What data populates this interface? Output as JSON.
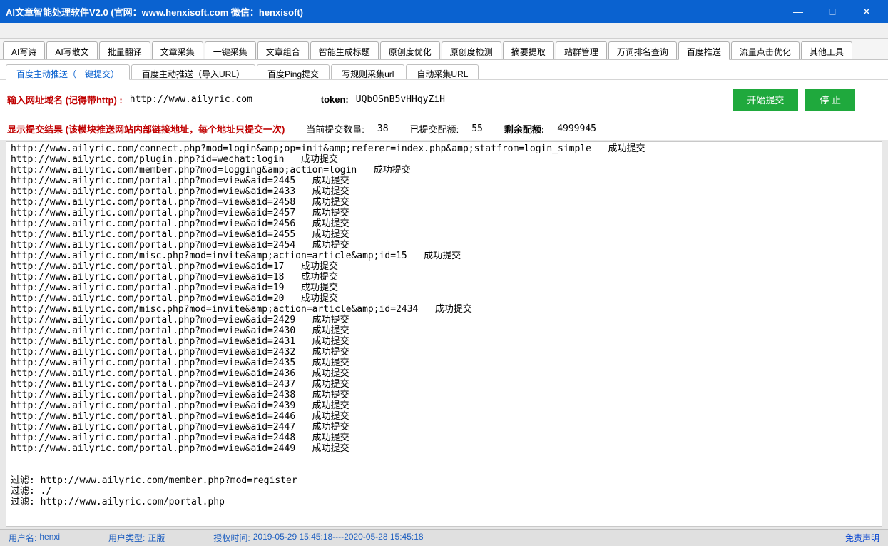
{
  "title": "AI文章智能处理软件V2.0  (官网：www.henxisoft.com  微信：henxisoft)",
  "tabs1": [
    "AI写诗",
    "AI写散文",
    "批量翻译",
    "文章采集",
    "一键采集",
    "文章组合",
    "智能生成标题",
    "原创度优化",
    "原创度检测",
    "摘要提取",
    "站群管理",
    "万词排名查询",
    "百度推送",
    "流量点击优化",
    "其他工具"
  ],
  "tabs1_active": 12,
  "tabs2": [
    "百度主动推送（一键提交）",
    "百度主动推送（导入URL）",
    "百度Ping提交",
    "写规则采集url",
    "自动采集URL"
  ],
  "tabs2_active": 0,
  "form": {
    "url_label": "输入网址域名 (记得带http) :",
    "url_value": "http://www.ailyric.com",
    "token_label": "token:",
    "token_value": "UQbOSnB5vHHqyZiH",
    "start_btn": "开始提交",
    "stop_btn": "停  止"
  },
  "stats": {
    "result_label": "显示提交结果  (该模块推送网站内部链接地址，每个地址只提交一次)",
    "current_label": "当前提交数量:",
    "current_value": "38",
    "submitted_label": "已提交配额:",
    "submitted_value": "55",
    "remain_label": "剩余配额:",
    "remain_value": "4999945"
  },
  "log": "http://www.ailyric.com/connect.php?mod=login&amp;op=init&amp;referer=index.php&amp;statfrom=login_simple   成功提交\nhttp://www.ailyric.com/plugin.php?id=wechat:login   成功提交\nhttp://www.ailyric.com/member.php?mod=logging&amp;action=login   成功提交\nhttp://www.ailyric.com/portal.php?mod=view&aid=2445   成功提交\nhttp://www.ailyric.com/portal.php?mod=view&aid=2433   成功提交\nhttp://www.ailyric.com/portal.php?mod=view&aid=2458   成功提交\nhttp://www.ailyric.com/portal.php?mod=view&aid=2457   成功提交\nhttp://www.ailyric.com/portal.php?mod=view&aid=2456   成功提交\nhttp://www.ailyric.com/portal.php?mod=view&aid=2455   成功提交\nhttp://www.ailyric.com/portal.php?mod=view&aid=2454   成功提交\nhttp://www.ailyric.com/misc.php?mod=invite&amp;action=article&amp;id=15   成功提交\nhttp://www.ailyric.com/portal.php?mod=view&aid=17   成功提交\nhttp://www.ailyric.com/portal.php?mod=view&aid=18   成功提交\nhttp://www.ailyric.com/portal.php?mod=view&aid=19   成功提交\nhttp://www.ailyric.com/portal.php?mod=view&aid=20   成功提交\nhttp://www.ailyric.com/misc.php?mod=invite&amp;action=article&amp;id=2434   成功提交\nhttp://www.ailyric.com/portal.php?mod=view&aid=2429   成功提交\nhttp://www.ailyric.com/portal.php?mod=view&aid=2430   成功提交\nhttp://www.ailyric.com/portal.php?mod=view&aid=2431   成功提交\nhttp://www.ailyric.com/portal.php?mod=view&aid=2432   成功提交\nhttp://www.ailyric.com/portal.php?mod=view&aid=2435   成功提交\nhttp://www.ailyric.com/portal.php?mod=view&aid=2436   成功提交\nhttp://www.ailyric.com/portal.php?mod=view&aid=2437   成功提交\nhttp://www.ailyric.com/portal.php?mod=view&aid=2438   成功提交\nhttp://www.ailyric.com/portal.php?mod=view&aid=2439   成功提交\nhttp://www.ailyric.com/portal.php?mod=view&aid=2446   成功提交\nhttp://www.ailyric.com/portal.php?mod=view&aid=2447   成功提交\nhttp://www.ailyric.com/portal.php?mod=view&aid=2448   成功提交\nhttp://www.ailyric.com/portal.php?mod=view&aid=2449   成功提交\n\n\n过滤: http://www.ailyric.com/member.php?mod=register\n过滤: ./\n过滤: http://www.ailyric.com/portal.php",
  "footer": {
    "user_label": "用户名:",
    "user_value": "henxi",
    "type_label": "用户类型:",
    "type_value": "正版",
    "auth_label": "授权时间:",
    "auth_value": "2019-05-29 15:45:18----2020-05-28 15:45:18",
    "disclaimer": "免责声明"
  }
}
